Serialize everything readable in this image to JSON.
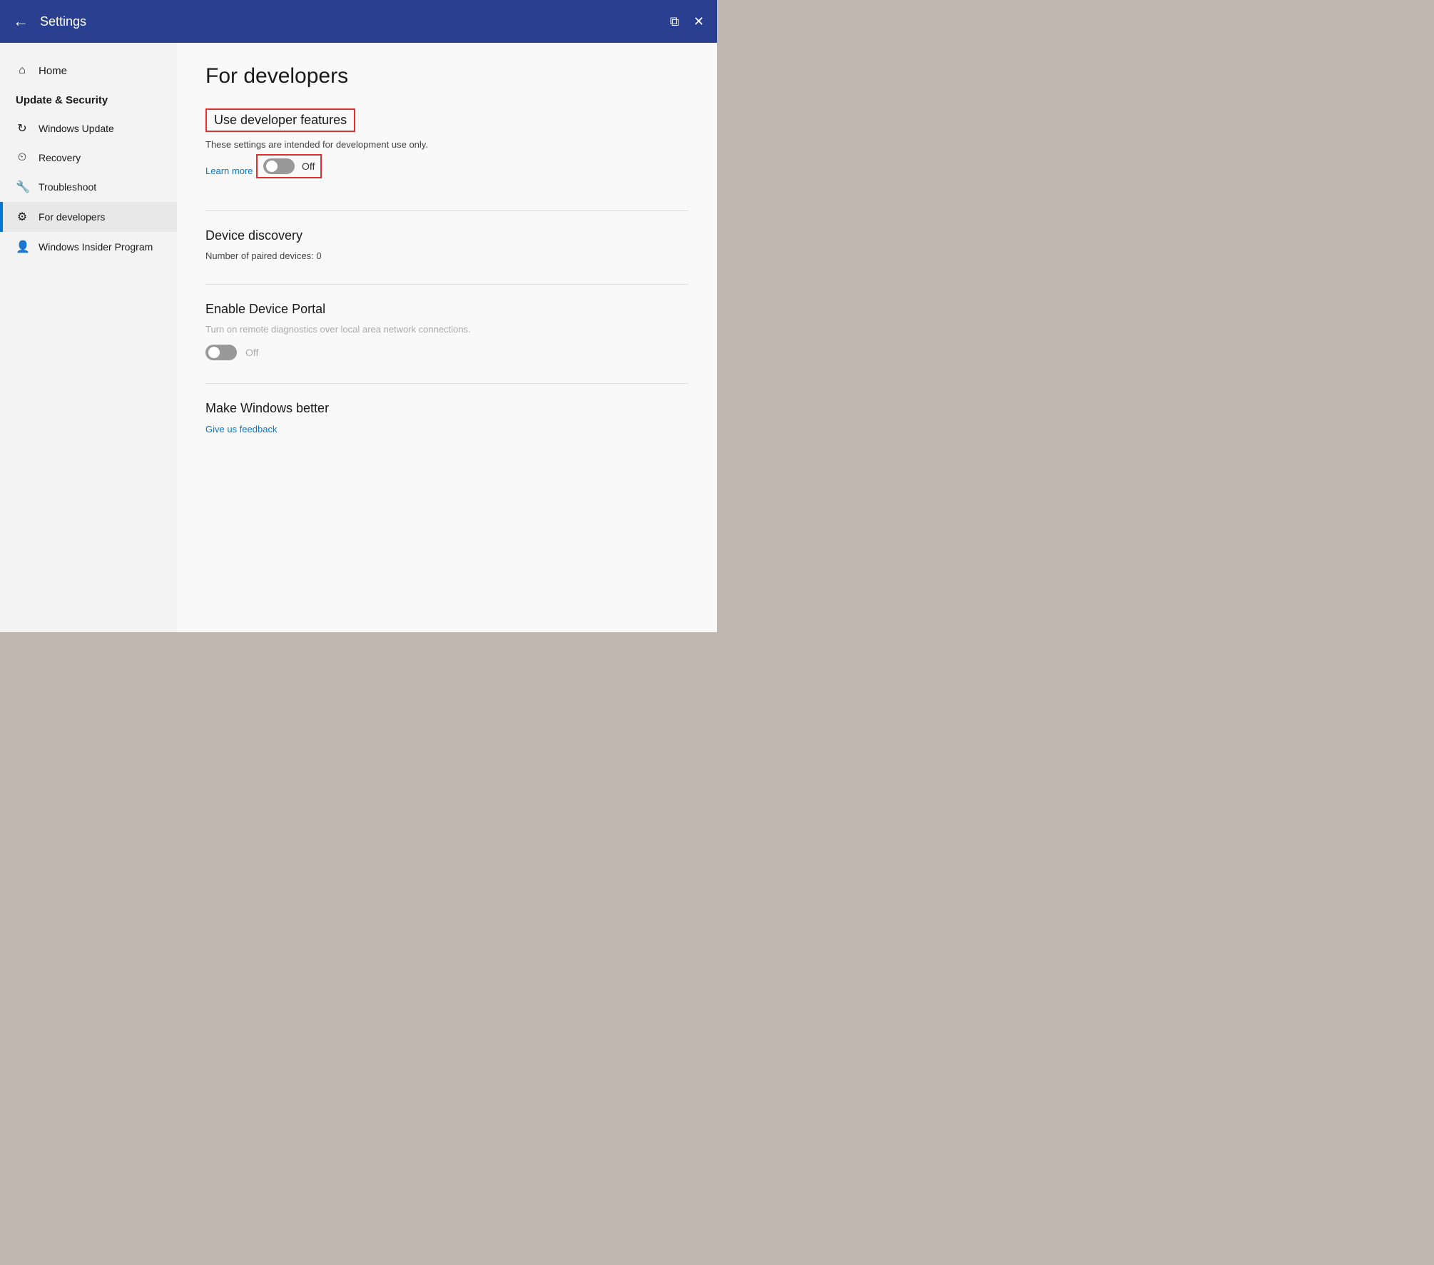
{
  "titleBar": {
    "backLabel": "←",
    "title": "Settings",
    "multiWindowIcon": "⧉",
    "closeIcon": "✕"
  },
  "sidebar": {
    "homeLabel": "Home",
    "homeIcon": "⌂",
    "sectionTitle": "Update & Security",
    "items": [
      {
        "id": "windows-update",
        "label": "Windows Update",
        "icon": "↻"
      },
      {
        "id": "recovery",
        "label": "Recovery",
        "icon": "⏲"
      },
      {
        "id": "troubleshoot",
        "label": "Troubleshoot",
        "icon": "🔧"
      },
      {
        "id": "for-developers",
        "label": "For developers",
        "icon": "⚙"
      },
      {
        "id": "windows-insider",
        "label": "Windows Insider Program",
        "icon": "👤"
      }
    ]
  },
  "content": {
    "pageTitle": "For developers",
    "sections": {
      "useDeveloperFeatures": {
        "title": "Use developer features",
        "description": "These settings are intended for development use only.",
        "learnMoreLabel": "Learn more",
        "toggleState": "off",
        "toggleLabel": "Off"
      },
      "deviceDiscovery": {
        "title": "Device discovery",
        "pairedDevicesLabel": "Number of paired devices: 0"
      },
      "enableDevicePortal": {
        "title": "Enable Device Portal",
        "description": "Turn on remote diagnostics over local area network connections.",
        "toggleState": "off",
        "toggleLabel": "Off"
      },
      "makeWindowsBetter": {
        "title": "Make Windows better",
        "feedbackLabel": "Give us feedback"
      }
    }
  }
}
